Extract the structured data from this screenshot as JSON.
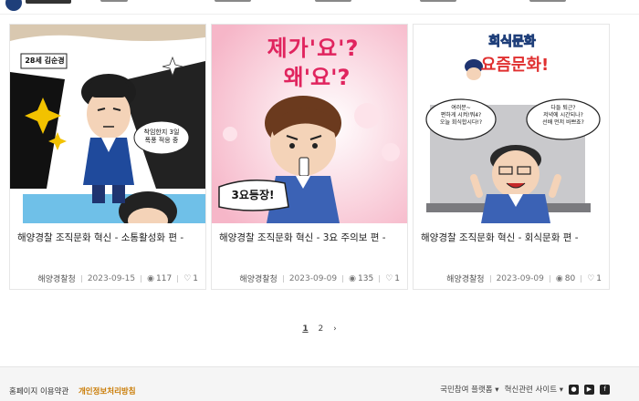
{
  "cards": [
    {
      "caption_age": "28세 김순경",
      "caption_note": "착임한지 3일\n폭풍 적응 중",
      "title": "해양경찰 조직문화 혁신 - 소통활성화 편 -",
      "org": "해양경찰청",
      "date": "2023-09-15",
      "views": "117",
      "likes": "1"
    },
    {
      "bubble_top": "제가'요'?",
      "bubble_mid": "왜'요'?",
      "stamp": "3요등장!",
      "title": "해양경찰 조직문화 혁신 - 3요 주의보 편 -",
      "org": "해양경찰청",
      "date": "2023-09-09",
      "views": "135",
      "likes": "1"
    },
    {
      "banner_line1": "회식문화",
      "banner_line2": "요즘문화!",
      "speech_left": "여러분~\n편하게 시켜!뭐4?\n오늘 회식합시다!?",
      "speech_right": "다들 퇴근?\n저녁에 시간되나?\n선배 먼저 바쁘죠?",
      "title": "해양경찰 조직문화 혁신 - 회식문화 편 -",
      "org": "해양경찰청",
      "date": "2023-09-09",
      "views": "80",
      "likes": "1"
    }
  ],
  "pagination": {
    "pages": [
      "1",
      "2"
    ],
    "current": "1",
    "next": "›"
  },
  "footer": {
    "terms": "홈페이지 이용약관",
    "privacy": "개인정보처리방침",
    "participation": "국민참여 플랫폼",
    "innovation": "혁신관련 사이트"
  },
  "icons": {
    "eye": "eye-icon",
    "heart": "heart-icon"
  },
  "colors": {
    "privacy": "#c97a00",
    "police_blue": "#1f4a9c"
  }
}
